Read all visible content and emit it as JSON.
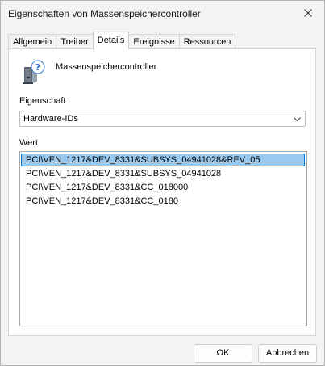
{
  "window": {
    "title": "Eigenschaften von Massenspeichercontroller"
  },
  "tabs": [
    {
      "label": "Allgemein",
      "active": false
    },
    {
      "label": "Treiber",
      "active": false
    },
    {
      "label": "Details",
      "active": true
    },
    {
      "label": "Ereignisse",
      "active": false
    },
    {
      "label": "Ressourcen",
      "active": false
    }
  ],
  "device": {
    "name": "Massenspeichercontroller",
    "icon": "unknown-device-icon"
  },
  "property": {
    "label": "Eigenschaft",
    "selected": "Hardware-IDs"
  },
  "values": {
    "label": "Wert",
    "items": [
      "PCI\\VEN_1217&DEV_8331&SUBSYS_04941028&REV_05",
      "PCI\\VEN_1217&DEV_8331&SUBSYS_04941028",
      "PCI\\VEN_1217&DEV_8331&CC_018000",
      "PCI\\VEN_1217&DEV_8331&CC_0180"
    ],
    "selected_index": 0
  },
  "buttons": {
    "ok": "OK",
    "cancel": "Abbrechen"
  },
  "colors": {
    "selection": "#99c9ef",
    "selection_border": "#0078d7",
    "window_bg": "#f3f3f3",
    "panel_bg": "#ffffff"
  }
}
